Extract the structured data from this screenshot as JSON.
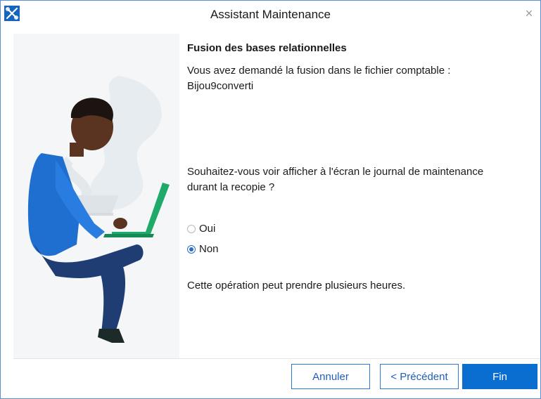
{
  "window": {
    "title": "Assistant Maintenance",
    "close_glyph": "×"
  },
  "icons": {
    "app": "tools-icon",
    "close": "close-icon"
  },
  "content": {
    "heading": "Fusion des bases relationnelles",
    "line1": "Vous avez demandé la fusion dans le fichier comptable :",
    "line2": "Bijou9converti",
    "question1": "Souhaitez-vous voir afficher à l'écran le journal de maintenance",
    "question2": "durant la recopie ?",
    "options": [
      {
        "label": "Oui",
        "selected": false
      },
      {
        "label": "Non",
        "selected": true
      }
    ],
    "note": "Cette opération peut prendre plusieurs heures."
  },
  "buttons": {
    "cancel": "Annuler",
    "previous": "< Précédent",
    "finish": "Fin"
  },
  "colors": {
    "accent": "#0a6ed1",
    "border": "#5a8fd8"
  }
}
